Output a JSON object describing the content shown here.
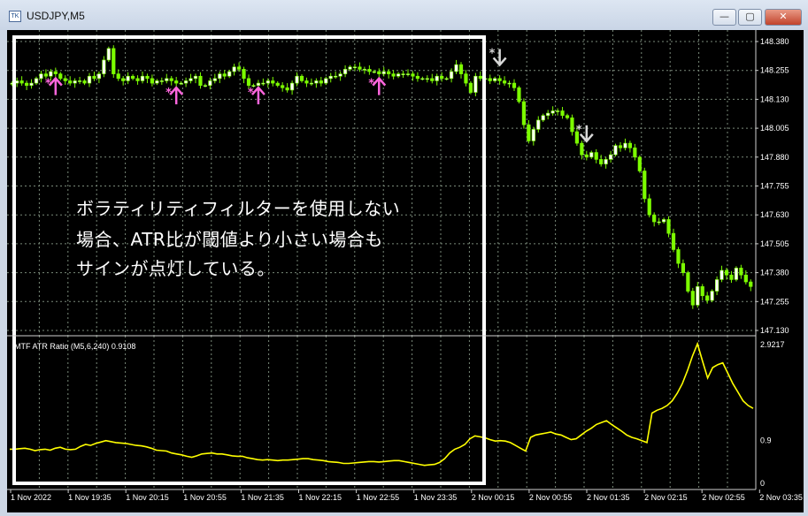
{
  "window": {
    "title": "USDJPY,M5",
    "app_icon_text": "TK",
    "minimize_glyph": "—",
    "maximize_glyph": "▢",
    "close_glyph": "✕"
  },
  "indicator": {
    "label": "MTF ATR Ratio  (M5,6,240) 0.9108"
  },
  "annotation": {
    "lines": [
      "ボラティリティフィルターを使用しない",
      "場合、ATR比が閾値より小さい場合も",
      "サインが点灯している。"
    ]
  },
  "chart_data": {
    "type": "candlestick",
    "symbol": "USDJPY",
    "timeframe": "M5",
    "price_axis": {
      "ticks": [
        "148.380",
        "148.255",
        "148.130",
        "148.005",
        "147.880",
        "147.755",
        "147.630",
        "147.505",
        "147.380",
        "147.255",
        "147.130"
      ],
      "range": [
        147.13,
        148.38
      ]
    },
    "indicator_axis": {
      "ticks": [
        "2.9217",
        "0.9",
        "0"
      ],
      "range": [
        0,
        2.9217
      ]
    },
    "time_ticks": [
      "1 Nov 2022",
      "1 Nov 19:35",
      "1 Nov 20:15",
      "1 Nov 20:55",
      "1 Nov 21:35",
      "1 Nov 22:15",
      "1 Nov 22:55",
      "1 Nov 23:35",
      "2 Nov 00:15",
      "2 Nov 00:55",
      "2 Nov 01:35",
      "2 Nov 02:15",
      "2 Nov 02:55",
      "2 Nov 03:35"
    ],
    "close_series": [
      148.2,
      148.21,
      148.2,
      148.19,
      148.2,
      148.22,
      148.24,
      148.23,
      148.25,
      148.24,
      148.22,
      148.21,
      148.2,
      148.21,
      148.21,
      148.2,
      148.23,
      148.22,
      148.24,
      148.3,
      148.35,
      148.24,
      148.22,
      148.21,
      148.23,
      148.22,
      148.21,
      148.23,
      148.22,
      148.2,
      148.21,
      148.21,
      148.22,
      148.21,
      148.2,
      148.2,
      148.21,
      148.22,
      148.23,
      148.19,
      148.19,
      148.21,
      148.22,
      148.24,
      148.23,
      148.25,
      148.27,
      148.26,
      148.22,
      148.19,
      148.19,
      148.2,
      148.2,
      148.21,
      148.2,
      148.19,
      148.18,
      148.17,
      148.2,
      148.23,
      148.21,
      148.2,
      148.2,
      148.21,
      148.2,
      148.22,
      148.23,
      148.23,
      148.24,
      148.26,
      148.27,
      148.27,
      148.26,
      148.26,
      148.25,
      148.25,
      148.24,
      148.25,
      148.24,
      148.23,
      148.24,
      148.24,
      148.24,
      148.23,
      148.22,
      148.22,
      148.22,
      148.21,
      148.23,
      148.22,
      148.22,
      148.25,
      148.28,
      148.24,
      148.2,
      148.16,
      148.23,
      148.22,
      148.22,
      148.21,
      148.22,
      148.21,
      148.2,
      148.2,
      148.18,
      148.12,
      148.02,
      147.95,
      148.0,
      148.04,
      148.06,
      148.07,
      148.08,
      148.08,
      148.06,
      148.05,
      147.99,
      147.94,
      147.89,
      147.88,
      147.9,
      147.87,
      147.85,
      147.87,
      147.89,
      147.93,
      147.92,
      147.94,
      147.92,
      147.88,
      147.82,
      147.7,
      147.63,
      147.6,
      147.6,
      147.61,
      147.55,
      147.48,
      147.42,
      147.38,
      147.3,
      147.24,
      147.32,
      147.28,
      147.26,
      147.3,
      147.35,
      147.39,
      147.37,
      147.35,
      147.4,
      147.37,
      147.34,
      147.32
    ],
    "buy_signals_at_index": [
      9,
      34,
      51,
      76
    ],
    "sell_signals_at_index": [
      101,
      119
    ],
    "atr_ratio_series": [
      0.7,
      0.7,
      0.71,
      0.72,
      0.7,
      0.67,
      0.69,
      0.7,
      0.68,
      0.72,
      0.74,
      0.7,
      0.69,
      0.7,
      0.76,
      0.8,
      0.78,
      0.82,
      0.85,
      0.88,
      0.86,
      0.84,
      0.83,
      0.82,
      0.8,
      0.78,
      0.77,
      0.75,
      0.72,
      0.68,
      0.67,
      0.66,
      0.62,
      0.6,
      0.58,
      0.55,
      0.53,
      0.56,
      0.6,
      0.61,
      0.62,
      0.6,
      0.6,
      0.58,
      0.56,
      0.55,
      0.55,
      0.52,
      0.5,
      0.48,
      0.47,
      0.48,
      0.47,
      0.46,
      0.47,
      0.47,
      0.48,
      0.49,
      0.5,
      0.5,
      0.48,
      0.47,
      0.46,
      0.44,
      0.43,
      0.42,
      0.4,
      0.4,
      0.41,
      0.42,
      0.43,
      0.44,
      0.44,
      0.43,
      0.44,
      0.45,
      0.46,
      0.46,
      0.44,
      0.42,
      0.4,
      0.38,
      0.36,
      0.37,
      0.38,
      0.42,
      0.5,
      0.62,
      0.7,
      0.74,
      0.8,
      0.92,
      0.98,
      0.96,
      0.94,
      0.9,
      0.87,
      0.88,
      0.87,
      0.84,
      0.78,
      0.72,
      0.66,
      0.95,
      1.0,
      1.02,
      1.04,
      1.06,
      1.02,
      1.0,
      0.95,
      0.9,
      0.92,
      1.0,
      1.08,
      1.14,
      1.22,
      1.26,
      1.3,
      1.22,
      1.15,
      1.08,
      1.0,
      0.95,
      0.92,
      0.88,
      0.84,
      1.46,
      1.52,
      1.56,
      1.62,
      1.72,
      1.88,
      2.08,
      2.35,
      2.66,
      2.92,
      2.55,
      2.2,
      2.42,
      2.48,
      2.52,
      2.3,
      2.08,
      1.9,
      1.72,
      1.62,
      1.56
    ]
  },
  "colors": {
    "background": "#000000",
    "grid": "#7a8a7a",
    "bull_candle": "#ffffff",
    "bear_candle": "#7cfc00",
    "wick": "#7cfc00",
    "buy_arrow": "#ff66dd",
    "sell_arrow": "#d8d8d8",
    "atr_line": "#ffff00",
    "highlight_box": "#ffffff",
    "axis_text": "#ffffff"
  }
}
